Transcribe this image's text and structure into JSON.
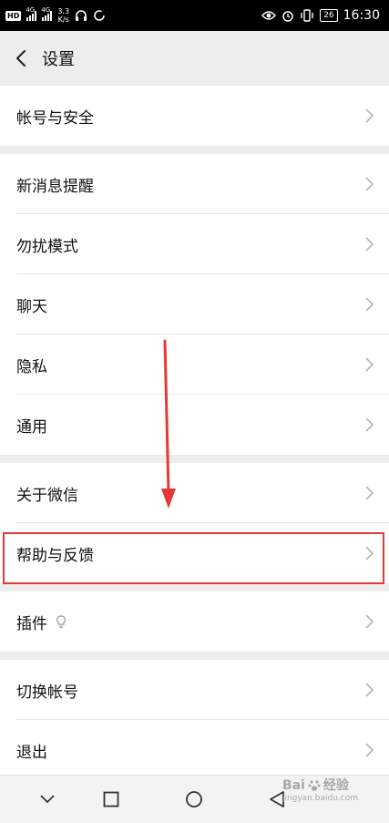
{
  "status_bar": {
    "hd": "HD",
    "net1": "4G",
    "net2": "4G",
    "speed_value": "3.3",
    "speed_unit": "K/s",
    "battery": "26",
    "time": "16:30"
  },
  "header": {
    "title": "设置"
  },
  "settings": {
    "account_security": "帐号与安全",
    "new_message_alert": "新消息提醒",
    "do_not_disturb": "勿扰模式",
    "chat": "聊天",
    "privacy": "隐私",
    "general": "通用",
    "about_wechat": "关于微信",
    "help_feedback": "帮助与反馈",
    "plugins": "插件",
    "switch_account": "切换帐号",
    "logout": "退出"
  },
  "watermark": {
    "brand": "Bai",
    "brand_suffix": "经验",
    "domain": "jingyan.baidu.com"
  },
  "colors": {
    "highlight": "#e53935",
    "background": "#ededed",
    "row": "#ffffff"
  }
}
